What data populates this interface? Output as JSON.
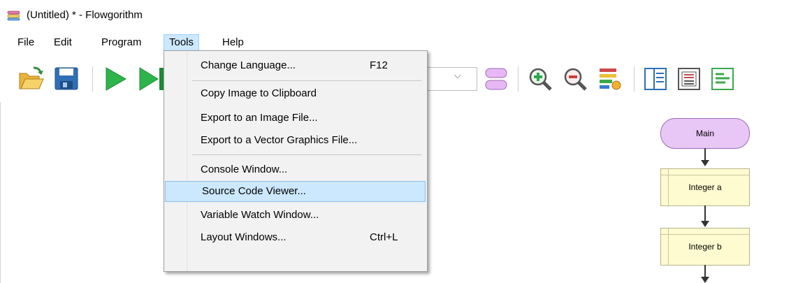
{
  "window": {
    "title": "(Untitled) * - Flowgorithm"
  },
  "menubar": {
    "items": [
      {
        "label": "File"
      },
      {
        "label": "Edit"
      },
      {
        "label": "Program"
      },
      {
        "label": "Tools"
      },
      {
        "label": "Help"
      }
    ],
    "open_menu": "Tools"
  },
  "toolbar": {
    "icons": [
      "open-folder-icon",
      "save-disk-icon",
      "run-play-icon",
      "step-forward-icon",
      "function-shape-icon",
      "zoom-in-icon",
      "zoom-out-icon",
      "chart-style-icon",
      "layout-split-icon",
      "layout-code-icon",
      "layout-watch-icon"
    ]
  },
  "tools_menu": {
    "items": [
      {
        "label": "Change Language...",
        "shortcut": "F12"
      },
      {
        "label": "Copy Image to Clipboard",
        "shortcut": ""
      },
      {
        "label": "Export to an Image File...",
        "shortcut": ""
      },
      {
        "label": "Export to a Vector Graphics File...",
        "shortcut": ""
      },
      {
        "label": "Console Window...",
        "shortcut": ""
      },
      {
        "label": "Source Code Viewer...",
        "shortcut": "",
        "highlighted": true
      },
      {
        "label": "Variable Watch Window...",
        "shortcut": ""
      },
      {
        "label": "Layout Windows...",
        "shortcut": "Ctrl+L"
      }
    ]
  },
  "flowchart": {
    "start_label": "Main",
    "declarations": [
      "Integer a",
      "Integer b"
    ]
  },
  "colors": {
    "menu_highlight": "#cce8ff",
    "start_fill": "#e8c6f5",
    "declare_fill": "#fffbd0",
    "run_green": "#2db44a"
  }
}
